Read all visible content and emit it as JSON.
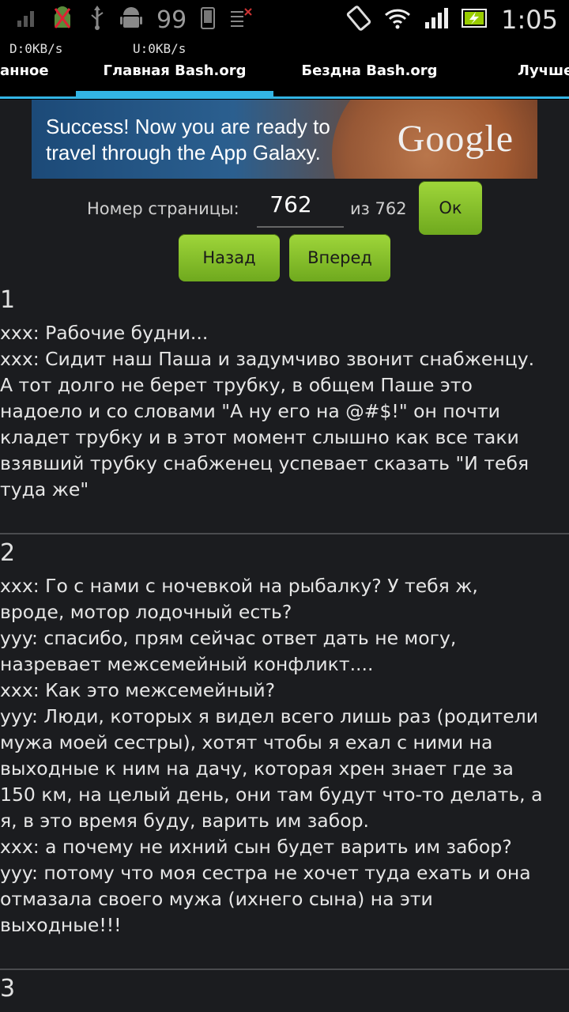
{
  "status_bar": {
    "notification_count": "99",
    "time": "1:05",
    "download_speed": "D:0KB/s",
    "upload_speed": "U:0KB/s",
    "icons": [
      "signal-icon",
      "android-bug-icon",
      "usb-icon",
      "android-icon",
      "phone-icon",
      "network-off-icon",
      "rotate-lock-icon",
      "wifi-icon",
      "cell-signal-icon",
      "battery-charging-icon"
    ]
  },
  "tabs": [
    {
      "label": "анное"
    },
    {
      "label": "Главная Bash.org"
    },
    {
      "label": "Бездна Bash.org"
    },
    {
      "label": "Лучше"
    }
  ],
  "ad": {
    "line1": "Success! Now you are ready to",
    "line2": "travel through the App Galaxy.",
    "brand": "Google"
  },
  "pagination": {
    "label": "Номер страницы:",
    "current": "762",
    "total_text": "из 762",
    "ok_label": "Ок",
    "back_label": "Назад",
    "forward_label": "Вперед"
  },
  "quotes": [
    {
      "number": "1",
      "text": "xxx: Рабочие будни...\nxxx: Сидит наш Паша и задумчиво звонит снабженцу.\nА тот долго не берет трубку, в общем Паше это\nнадоело и со словами \"А ну его на @#$!\" он почти\nкладет трубку и в этот момент слышно как все таки\nвзявший трубку снабженец успевает сказать \"И тебя\nтуда же\""
    },
    {
      "number": "2",
      "text": "xxx: Го с нами с ночевкой на рыбалку? У тебя ж,\nвроде, мотор лодочный есть?\nyyy: спасибо, прям сейчас ответ дать не могу,\nназревает межсемейный конфликт....\nxxx: Как это межсемейный?\nyyy: Люди, которых я видел всего лишь раз (родители\nмужа моей сестры), хотят чтобы я ехал с ними на\nвыходные к ним на дачу, которая хрен знает где за\n150 км, на целый день, они там будут что-то делать, а\nя, в это время буду, варить им забор.\nxxx: а почему не ихний сын будет варить им забор?\nyyy: потому что моя сестра не хочет туда ехать и она\nотмазала своего мужа (ихнего сына) на эти\nвыходные!!!"
    },
    {
      "number": "3",
      "text": ""
    }
  ]
}
